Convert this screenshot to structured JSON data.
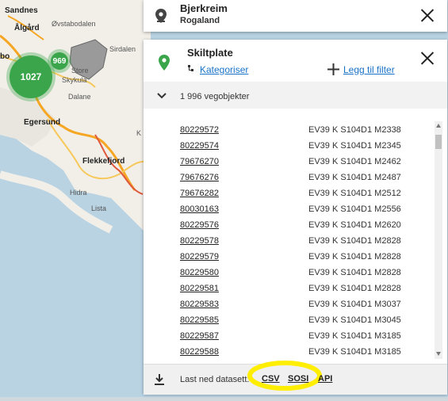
{
  "map": {
    "places": {
      "sandnes": "Sandnes",
      "algard": "Ålgård",
      "ovstabodalen": "Øvstabodalen",
      "sirdalen": "Sirdalen",
      "store": "Store",
      "skykula": "Skykula",
      "dalane": "Dalane",
      "egersund": "Egersund",
      "flekkefjord": "Flekkefjord",
      "hidra": "Hidra",
      "lista": "Lista",
      "bo": "bo",
      "k": "K"
    },
    "clusters": {
      "large": "1027",
      "small": "969"
    }
  },
  "location": {
    "title": "Bjerkreim",
    "subtitle": "Rogaland",
    "pin_icon": "map-pin-icon",
    "close_icon": "close-icon"
  },
  "object": {
    "title": "Skiltplate",
    "categorize_label": "Kategoriser",
    "add_filter_label": "Legg til filter",
    "count_label": "1 996 vegobjekter",
    "pin_color": "#3aa54a",
    "rows": [
      {
        "id": "80229572",
        "loc": "EV39 K S104D1 M2338"
      },
      {
        "id": "80229574",
        "loc": "EV39 K S104D1 M2345"
      },
      {
        "id": "79676270",
        "loc": "EV39 K S104D1 M2462"
      },
      {
        "id": "79676276",
        "loc": "EV39 K S104D1 M2487"
      },
      {
        "id": "79676282",
        "loc": "EV39 K S104D1 M2512"
      },
      {
        "id": "80030163",
        "loc": "EV39 K S104D1 M2556"
      },
      {
        "id": "80229576",
        "loc": "EV39 K S104D1 M2620"
      },
      {
        "id": "80229578",
        "loc": "EV39 K S104D1 M2828"
      },
      {
        "id": "80229579",
        "loc": "EV39 K S104D1 M2828"
      },
      {
        "id": "80229580",
        "loc": "EV39 K S104D1 M2828"
      },
      {
        "id": "80229581",
        "loc": "EV39 K S104D1 M2828"
      },
      {
        "id": "80229583",
        "loc": "EV39 K S104D1 M3037"
      },
      {
        "id": "80229585",
        "loc": "EV39 K S104D1 M3045"
      },
      {
        "id": "80229587",
        "loc": "EV39 K S104D1 M3185"
      },
      {
        "id": "80229588",
        "loc": "EV39 K S104D1 M3185"
      }
    ],
    "footer": {
      "label": "Last ned datasett:",
      "csv": "CSV",
      "sosi": "SOSI",
      "api": "API",
      "highlight_color": "#ffee00"
    }
  }
}
